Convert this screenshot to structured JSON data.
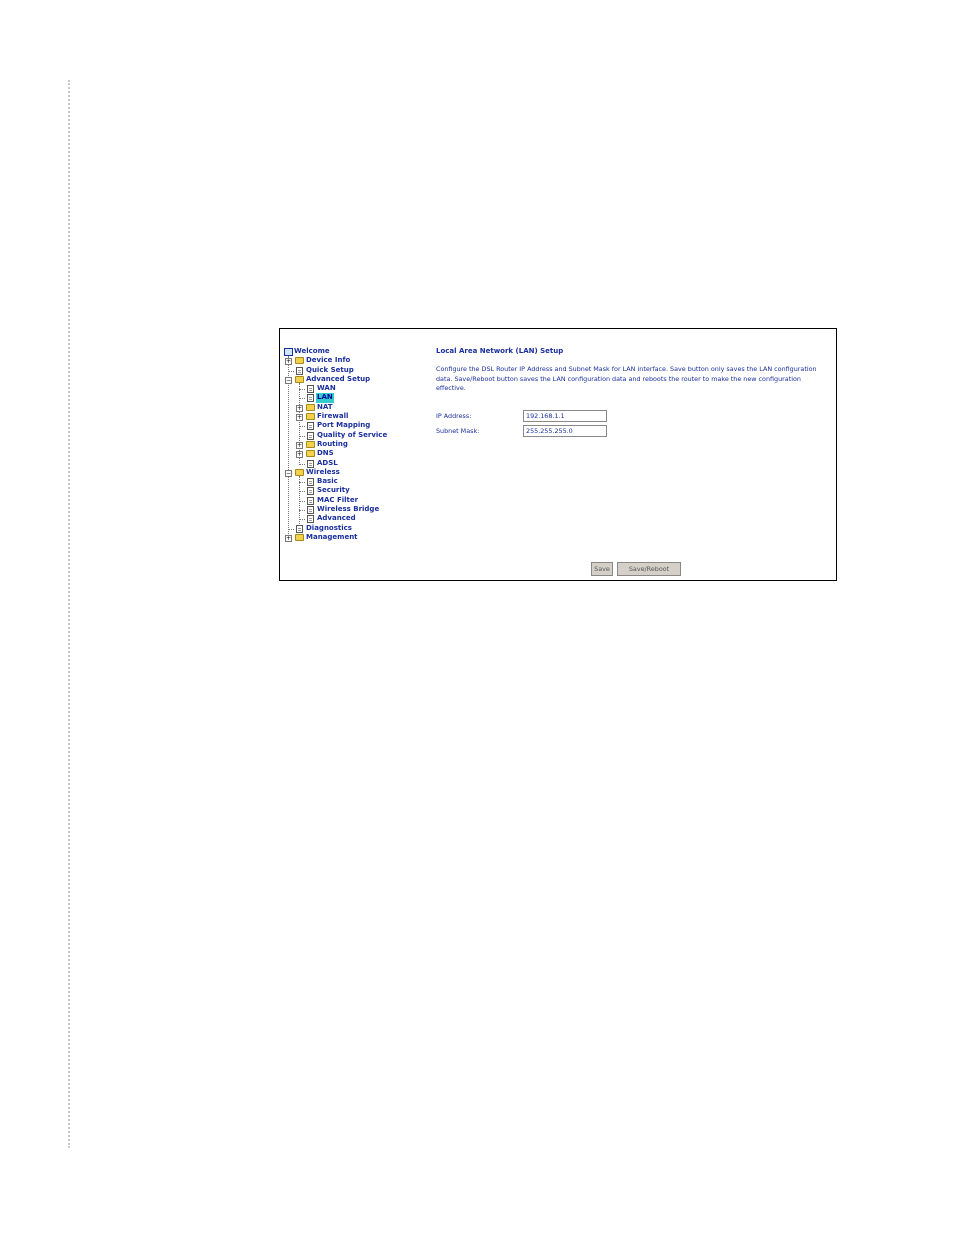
{
  "nav": {
    "welcome": "Welcome",
    "device_info": "Device Info",
    "quick_setup": "Quick Setup",
    "advanced_setup": "Advanced Setup",
    "wan": "WAN",
    "lan": "LAN",
    "nat": "NAT",
    "firewall": "Firewall",
    "port_mapping": "Port Mapping",
    "qos": "Quality of Service",
    "routing": "Routing",
    "dns": "DNS",
    "adsl": "ADSL",
    "wireless": "Wireless",
    "basic": "Basic",
    "security": "Security",
    "mac_filter": "MAC Filter",
    "wireless_bridge": "Wireless Bridge",
    "advanced": "Advanced",
    "diagnostics": "Diagnostics",
    "management": "Management"
  },
  "main": {
    "title": "Local Area Network (LAN) Setup",
    "description": "Configure the DSL Router IP Address and Subnet Mask for LAN interface.  Save button only saves the LAN configuration data.  Save/Reboot button saves the LAN configuration data and reboots the router to make the new configuration effective.",
    "ip_label": "IP Address:",
    "ip_value": "192.168.1.1",
    "mask_label": "Subnet Mask:",
    "mask_value": "255.255.255.0",
    "save_label": "Save",
    "save_reboot_label": "Save/Reboot"
  },
  "colors": {
    "link": "#1a2f9c",
    "selected_bg": "#33cccc"
  }
}
